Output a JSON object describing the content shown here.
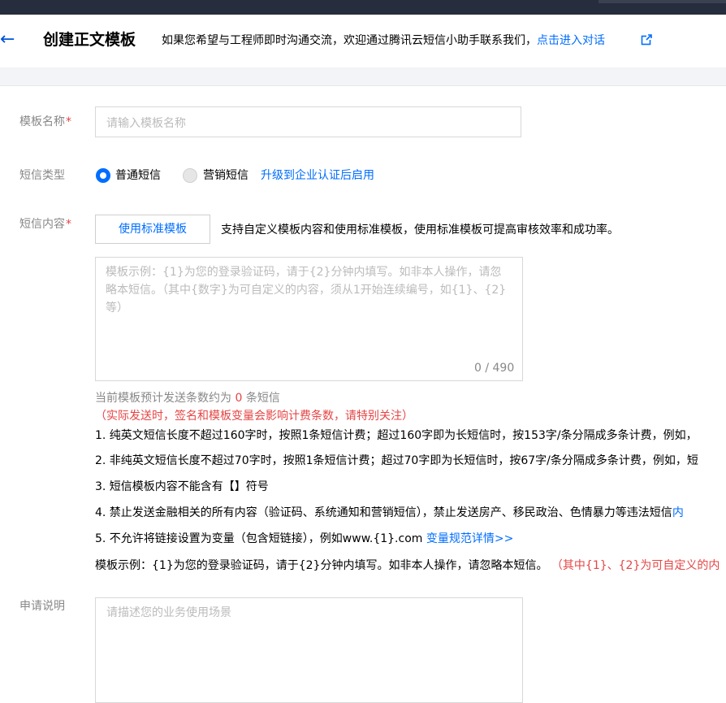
{
  "header": {
    "title": "创建正文模板",
    "hint_prefix": "如果您希望与工程师即时沟通交流，欢迎通过腾讯云短信小助手联系我们，",
    "hint_link": "点击进入对话"
  },
  "form": {
    "name": {
      "label": "模板名称",
      "placeholder": "请输入模板名称"
    },
    "type": {
      "label": "短信类型",
      "options": [
        {
          "label": "普通短信",
          "selected": true
        },
        {
          "label": "营销短信",
          "selected": false
        }
      ],
      "upgrade_link": "升级到企业认证后启用"
    },
    "content": {
      "label": "短信内容",
      "std_button": "使用标准模板",
      "std_hint": "支持自定义模板内容和使用标准模板，使用标准模板可提高审核效率和成功率。",
      "placeholder": "模板示例：{1}为您的登录验证码，请于{2}分钟内填写。如非本人操作，请忽略本短信。（其中{数字}为可自定义的内容，须从1开始连续编号，如{1}、{2}等）",
      "counter": "0 / 490",
      "estimate_prefix": "当前模板预计发送条数约为",
      "estimate_count": "0",
      "estimate_suffix": "条短信",
      "estimate_warning": "（实际发送时，签名和模板变量会影响计费条数，请特别关注）",
      "rules": [
        "1. 纯英文短信长度不超过160字时，按照1条短信计费；超过160字即为长短信时，按153字/条分隔成多条计费，例如，",
        "2. 非纯英文短信长度不超过70字时，按照1条短信计费；超过70字即为长短信时，按67字/条分隔成多条计费，例如，短",
        "3. 短信模板内容不能含有【】符号",
        "4. 禁止发送金融相关的所有内容（验证码、系统通知和营销短信），禁止发送房产、移民政治、色情暴力等违法短信"
      ],
      "rule4_link": "内",
      "rule5_text": "5. 不允许将链接设置为变量（包含短链接），例如www.{1}.com",
      "rule5_link": "变量规范详情>>",
      "example_text": "模板示例：{1}为您的登录验证码，请于{2}分钟内填写。如非本人操作，请忽略本短信。",
      "example_note": "（其中{1}、{2}为可自定义的内"
    },
    "desc": {
      "label": "申请说明",
      "placeholder": "请描述您的业务使用场景"
    }
  },
  "colors": {
    "accent": "#006eff",
    "warn": "#e54545",
    "topbar": "#262e3d"
  }
}
